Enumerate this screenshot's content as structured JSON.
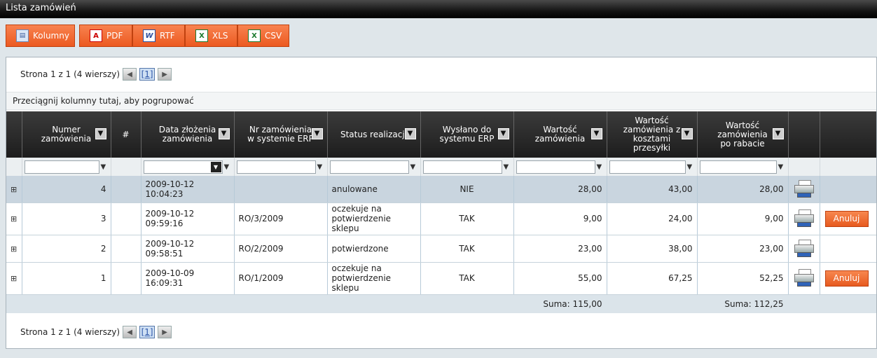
{
  "window": {
    "title": "Lista zamówień"
  },
  "toolbar": {
    "columns_label": "Kolumny",
    "pdf_label": "PDF",
    "rtf_label": "RTF",
    "xls_label": "XLS",
    "csv_label": "CSV"
  },
  "pager": {
    "text": "Strona 1 z 1 (4 wierszy)",
    "page": "[1]"
  },
  "group_hint": "Przeciągnij kolumny tutaj, aby pogrupować",
  "columns": {
    "number": "Numer zamówienia",
    "hash": "#",
    "date": "Data złożenia zamówienia",
    "erp_no": "Nr zamówienia w systemie ERP",
    "status": "Status realizacji",
    "sent_erp": "Wysłano do systemu ERP",
    "value": "Wartość zamówienia",
    "value_shipping": "Wartość zamówienia z kosztami przesyłki",
    "value_discount": "Wartość zamówienia po rabacie"
  },
  "rows": [
    {
      "number": "4",
      "date": "2009-10-12 10:04:23",
      "erp_no": "",
      "status": "anulowane",
      "sent": "NIE",
      "value": "28,00",
      "value_shipping": "43,00",
      "value_discount": "28,00",
      "action": ""
    },
    {
      "number": "3",
      "date": "2009-10-12 09:59:16",
      "erp_no": "RO/3/2009",
      "status": "oczekuje na potwierdzenie sklepu",
      "sent": "TAK",
      "value": "9,00",
      "value_shipping": "24,00",
      "value_discount": "9,00",
      "action": "Anuluj"
    },
    {
      "number": "2",
      "date": "2009-10-12 09:58:51",
      "erp_no": "RO/2/2009",
      "status": "potwierdzone",
      "sent": "TAK",
      "value": "23,00",
      "value_shipping": "38,00",
      "value_discount": "23,00",
      "action": ""
    },
    {
      "number": "1",
      "date": "2009-10-09 16:09:31",
      "erp_no": "RO/1/2009",
      "status": "oczekuje na potwierdzenie sklepu",
      "sent": "TAK",
      "value": "55,00",
      "value_shipping": "67,25",
      "value_discount": "52,25",
      "action": "Anuluj"
    }
  ],
  "totals": {
    "value": "Suma: 115,00",
    "value_discount": "Suma: 112,25"
  },
  "icons": {
    "columns": "columns-icon",
    "pdf": "pdf-icon",
    "rtf": "rtf-icon",
    "xls": "excel-icon",
    "csv": "csv-icon",
    "sort": "sort-arrow-icon",
    "filter": "filter-icon",
    "expand": "expand-icon",
    "print": "printer-icon"
  },
  "colors": {
    "accent": "#f06a2e",
    "header_bg": "#2a2a2a",
    "selected_row": "#c9d5df"
  }
}
